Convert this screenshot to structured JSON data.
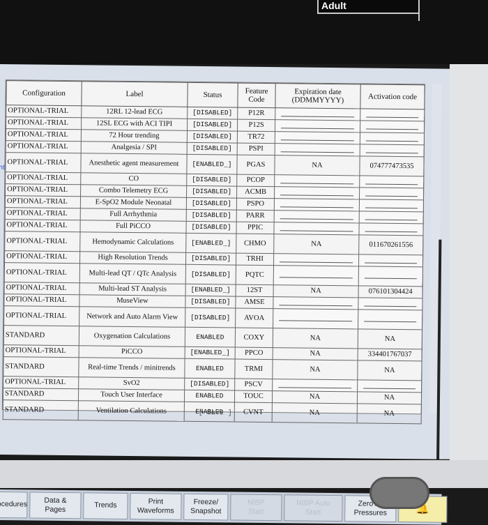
{
  "header": {
    "patient_category": "Adult"
  },
  "side_label": "nt",
  "table": {
    "columns": [
      "Configuration",
      "Label",
      "Status",
      "Feature Code",
      "Expiration date (DDMMYYYY)",
      "Activation code"
    ],
    "rows": [
      {
        "config": "OPTIONAL-TRIAL",
        "label": "12RL 12-lead ECG",
        "status": "[DISABLED]",
        "code": "P12R",
        "exp": "",
        "act": ""
      },
      {
        "config": "OPTIONAL-TRIAL",
        "label": "12SL ECG with ACI TIPI",
        "status": "[DISABLED]",
        "code": "P12S",
        "exp": "",
        "act": ""
      },
      {
        "config": "OPTIONAL-TRIAL",
        "label": "72 Hour trending",
        "status": "[DISABLED]",
        "code": "TR72",
        "exp": "",
        "act": ""
      },
      {
        "config": "OPTIONAL-TRIAL",
        "label": "Analgesia / SPI",
        "status": "[DISABLED]",
        "code": "PSPI",
        "exp": "",
        "act": ""
      },
      {
        "config": "OPTIONAL-TRIAL",
        "label": "Anesthetic agent measurement",
        "status": "[ENABLED_]",
        "code": "PGAS",
        "exp": "NA",
        "act": "074777473535"
      },
      {
        "config": "OPTIONAL-TRIAL",
        "label": "CO",
        "status": "[DISABLED]",
        "code": "PCOP",
        "exp": "",
        "act": ""
      },
      {
        "config": "OPTIONAL-TRIAL",
        "label": "Combo Telemetry ECG",
        "status": "[DISABLED]",
        "code": "ACMB",
        "exp": "",
        "act": ""
      },
      {
        "config": "OPTIONAL-TRIAL",
        "label": "E-SpO2 Module Neonatal",
        "status": "[DISABLED]",
        "code": "PSPO",
        "exp": "",
        "act": ""
      },
      {
        "config": "OPTIONAL-TRIAL",
        "label": "Full Arrhythmia",
        "status": "[DISABLED]",
        "code": "PARR",
        "exp": "",
        "act": ""
      },
      {
        "config": "OPTIONAL-TRIAL",
        "label": "Full PiCCO",
        "status": "[DISABLED]",
        "code": "PPIC",
        "exp": "",
        "act": ""
      },
      {
        "config": "OPTIONAL-TRIAL",
        "label": "Hemodynamic Calculations",
        "status": "[ENABLED_]",
        "code": "CHMO",
        "exp": "NA",
        "act": "011670261556"
      },
      {
        "config": "OPTIONAL-TRIAL",
        "label": "High Resolution Trends",
        "status": "[DISABLED]",
        "code": "TRHI",
        "exp": "",
        "act": ""
      },
      {
        "config": "OPTIONAL-TRIAL",
        "label": "Multi-lead QT / QTc Analysis",
        "status": "[DISABLED]",
        "code": "PQTC",
        "exp": "",
        "act": ""
      },
      {
        "config": "OPTIONAL-TRIAL",
        "label": "Multi-lead ST Analysis",
        "status": "[ENABLED_]",
        "code": "12ST",
        "exp": "NA",
        "act": "076101304424"
      },
      {
        "config": "OPTIONAL-TRIAL",
        "label": "MuseView",
        "status": "[DISABLED]",
        "code": "AMSE",
        "exp": "",
        "act": ""
      },
      {
        "config": "OPTIONAL-TRIAL",
        "label": "Network and Auto Alarm View",
        "status": "[DISABLED]",
        "code": "AVOA",
        "exp": "",
        "act": ""
      },
      {
        "config": "STANDARD",
        "label": "Oxygenation Calculations",
        "status": "ENABLED",
        "code": "COXY",
        "exp": "NA",
        "act": "NA"
      },
      {
        "config": "OPTIONAL-TRIAL",
        "label": "PiCCO",
        "status": "[ENABLED_]",
        "code": "PPCO",
        "exp": "NA",
        "act": "334401767037"
      },
      {
        "config": "STANDARD",
        "label": "Real-time Trends / minitrends",
        "status": "ENABLED",
        "code": "TRMI",
        "exp": "NA",
        "act": "NA"
      },
      {
        "config": "OPTIONAL-TRIAL",
        "label": "SvO2",
        "status": "[DISABLED]",
        "code": "PSCV",
        "exp": "",
        "act": ""
      },
      {
        "config": "STANDARD",
        "label": "Touch User Interface",
        "status": "ENABLED",
        "code": "TOUC",
        "exp": "NA",
        "act": "NA"
      },
      {
        "config": "STANDARD",
        "label": "Ventilation Calculations",
        "status": "ENABLED",
        "code": "CVNT",
        "exp": "NA",
        "act": "NA"
      }
    ]
  },
  "save_label": "[ Save ]",
  "buttons": [
    {
      "name": "procedures",
      "label": "ocedures",
      "disabled": false
    },
    {
      "name": "data-pages",
      "label": "Data &\nPages",
      "disabled": false
    },
    {
      "name": "trends",
      "label": "Trends",
      "disabled": false
    },
    {
      "name": "print-waveforms",
      "label": "Print\nWaveforms",
      "disabled": false
    },
    {
      "name": "freeze-snapshot",
      "label": "Freeze/\nSnapshot",
      "disabled": false
    },
    {
      "name": "nibp-start",
      "label": "NIBP\nStart",
      "disabled": true
    },
    {
      "name": "nibp-auto-start",
      "label": "NIBP Auto\nStart",
      "disabled": true
    },
    {
      "name": "zero-all-pressures",
      "label": "Zero All\nPressures",
      "disabled": false
    },
    {
      "name": "alarm",
      "label": "",
      "disabled": false
    }
  ]
}
